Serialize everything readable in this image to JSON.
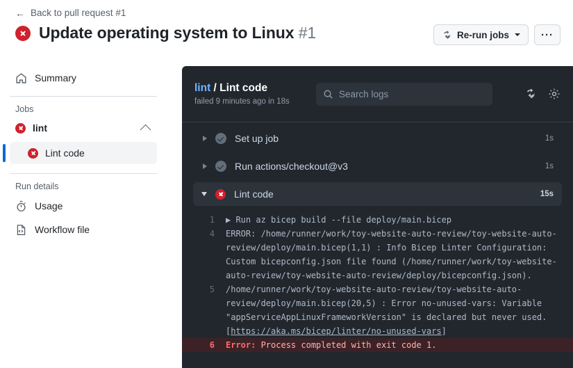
{
  "header": {
    "back_link": "Back to pull request #1",
    "back_icon": "arrow-left-icon",
    "title": "Update operating system to Linux",
    "title_number": "#1",
    "status_icon": "failed-x-icon",
    "rerun_button": "Re-run jobs",
    "rerun_icon": "sync-icon",
    "more_button": "···"
  },
  "sidebar": {
    "summary": {
      "label": "Summary",
      "icon": "home-icon"
    },
    "jobs_heading": "Jobs",
    "job": {
      "label": "lint",
      "status_icon": "failed-x-icon",
      "collapse_icon": "chevron-up-icon"
    },
    "step": {
      "label": "Lint code",
      "status_icon": "failed-x-icon"
    },
    "run_details_heading": "Run details",
    "details": [
      {
        "label": "Usage",
        "icon": "stopwatch-icon"
      },
      {
        "label": "Workflow file",
        "icon": "file-code-icon"
      }
    ]
  },
  "log_panel": {
    "title_job": "lint",
    "title_sep": " / ",
    "title_step": "Lint code",
    "subtitle": "failed 9 minutes ago in 18s",
    "search": {
      "placeholder": "Search logs",
      "value": "",
      "icon": "search-icon"
    },
    "refresh_icon": "sync-icon",
    "settings_icon": "gear-icon",
    "steps": [
      {
        "name": "Set up job",
        "duration": "1s",
        "state": "success",
        "expanded": false
      },
      {
        "name": "Run actions/checkout@v3",
        "duration": "1s",
        "state": "success",
        "expanded": false
      },
      {
        "name": "Lint code",
        "duration": "15s",
        "state": "failure",
        "expanded": true
      }
    ],
    "log_lines": [
      {
        "num": "1",
        "text": "▶ Run az bicep build --file deploy/main.bicep",
        "type": "normal"
      },
      {
        "num": "4",
        "text": "ERROR: /home/runner/work/toy-website-auto-review/toy-website-auto-review/deploy/main.bicep(1,1) : Info Bicep Linter Configuration: Custom bicepconfig.json file found (/home/runner/work/toy-website-auto-review/toy-website-auto-review/deploy/bicepconfig.json).",
        "type": "normal"
      },
      {
        "num": "5",
        "text": "/home/runner/work/toy-website-auto-review/toy-website-auto-review/deploy/main.bicep(20,5) : Error no-unused-vars: Variable \"appServiceAppLinuxFrameworkVersion\" is declared but never used. [",
        "link": "https://aka.ms/bicep/linter/no-unused-vars",
        "text_after": "]",
        "type": "link"
      },
      {
        "num": "6",
        "prefix": "Error:",
        "text": " Process completed with exit code 1.",
        "type": "error"
      }
    ]
  },
  "colors": {
    "danger": "#cf222e",
    "accent": "#0969da",
    "panel_bg": "#22272e",
    "panel_row": "#2d333b",
    "error_bg": "#3c2226",
    "error_text": "#ff6a69",
    "link_dark": "#6cb6ff"
  }
}
